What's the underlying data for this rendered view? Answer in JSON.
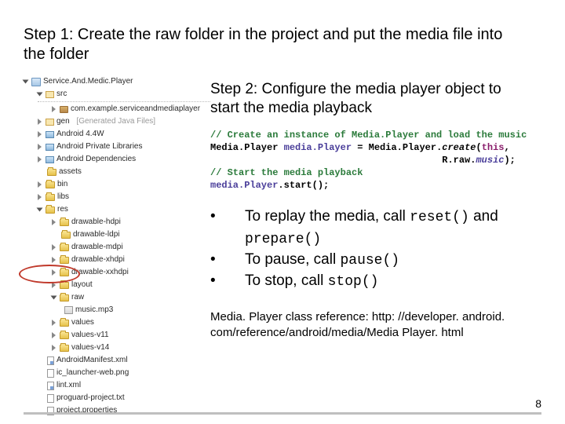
{
  "step1": "Step 1: Create the raw folder in the project and put the media file into the folder",
  "step2": "Step 2: Configure the media player object to start the media playback",
  "code": {
    "c1": "// Create an instance of Media.Player and load the music",
    "l1a": "Media.Player ",
    "l1b": "media.Player",
    "l1c": " = Media.Player.",
    "l1d": "create",
    "l1e": "(",
    "l1f": "this",
    "l1g": ",",
    "l2": "                                         R.raw.",
    "l2b": "music",
    "l2c": ");",
    "c2": "// Start the media playback",
    "l3a": "media.Player",
    "l3b": ".start();"
  },
  "bullets": {
    "b1a": "To replay the media, call ",
    "b1b": "reset()",
    "b1c": " and ",
    "b1d": "prepare()",
    "b2a": "To pause, call ",
    "b2b": "pause()",
    "b3a": "To stop, call ",
    "b3b": "stop()"
  },
  "ref": "Media. Player class reference: http: //developer. android. com/reference/android/media/Media Player. html",
  "pagenum": "8",
  "tree": {
    "root": "Service.And.Medic.Player",
    "src": "src",
    "pkg": "com.example.serviceandmediaplayer",
    "gen": "gen",
    "gen_note": "[Generated Java Files]",
    "a44w": "Android 4.4W",
    "apl": "Android Private Libraries",
    "adep": "Android Dependencies",
    "assets": "assets",
    "bin": "bin",
    "libs": "libs",
    "res": "res",
    "dh": "drawable-hdpi",
    "dl": "drawable-ldpi",
    "dm": "drawable-mdpi",
    "dxh": "drawable-xhdpi",
    "dxxh": "drawable-xxhdpi",
    "layout": "layout",
    "raw": "raw",
    "mp3": "music.mp3",
    "values": "values",
    "v11": "values-v11",
    "v14": "values-v14",
    "manifest": "AndroidManifest.xml",
    "iclaunch": "ic_launcher-web.png",
    "lintxml": "lint.xml",
    "proguard": "proguard-project.txt",
    "projprop": "project.properties"
  }
}
